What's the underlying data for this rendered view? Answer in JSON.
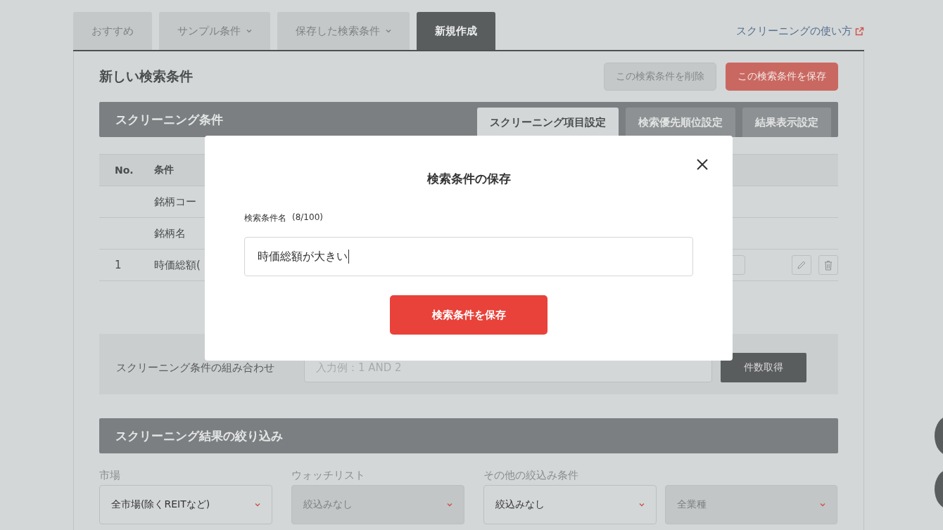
{
  "tabs": [
    {
      "label": "おすすめ",
      "has_dropdown": false,
      "selected": false
    },
    {
      "label": "サンプル条件",
      "has_dropdown": true,
      "selected": false
    },
    {
      "label": "保存した検索条件",
      "has_dropdown": true,
      "selected": false
    },
    {
      "label": "新規作成",
      "has_dropdown": false,
      "selected": true
    }
  ],
  "help_link": {
    "label": "スクリーニングの使い方"
  },
  "page_title": "新しい検索条件",
  "actions": [
    {
      "label": "この検索条件を削除",
      "kind": "delete",
      "disabled": true
    },
    {
      "label": "この検索条件を保存",
      "kind": "save",
      "disabled": false
    }
  ],
  "conditions": {
    "title": "スクリーニング条件",
    "subtabs": [
      {
        "label": "スクリーニング項目設定",
        "selected": true
      },
      {
        "label": "検索優先順位設定",
        "selected": false
      },
      {
        "label": "結果表示設定",
        "selected": false
      }
    ],
    "columns": [
      "No.",
      "条件"
    ],
    "rows": [
      {
        "no": "",
        "condition": "銘柄コー",
        "editable": false
      },
      {
        "no": "",
        "condition": "銘柄名",
        "editable": false
      },
      {
        "no": "1",
        "condition": "時価総額(",
        "editable": true
      }
    ]
  },
  "combination": {
    "label": "スクリーニング条件の組み合わせ",
    "placeholder": "入力例：1 AND 2",
    "button": "件数取得"
  },
  "filters": {
    "title": "スクリーニング結果の絞り込み",
    "fields": [
      {
        "label": "市場",
        "value": "全市場(除くREITなど)",
        "disabled": false
      },
      {
        "label": "ウォッチリスト",
        "value": "絞込みなし",
        "disabled": true
      },
      {
        "label": "その他の絞込み条件",
        "value": "絞込みなし",
        "disabled": false
      },
      {
        "value": "全業種",
        "disabled": true
      }
    ]
  },
  "modal": {
    "title": "検索条件の保存",
    "field_label": "検索条件名",
    "counter": "(8/100)",
    "value": "時価総額が大きい",
    "submit": "検索条件を保存"
  }
}
